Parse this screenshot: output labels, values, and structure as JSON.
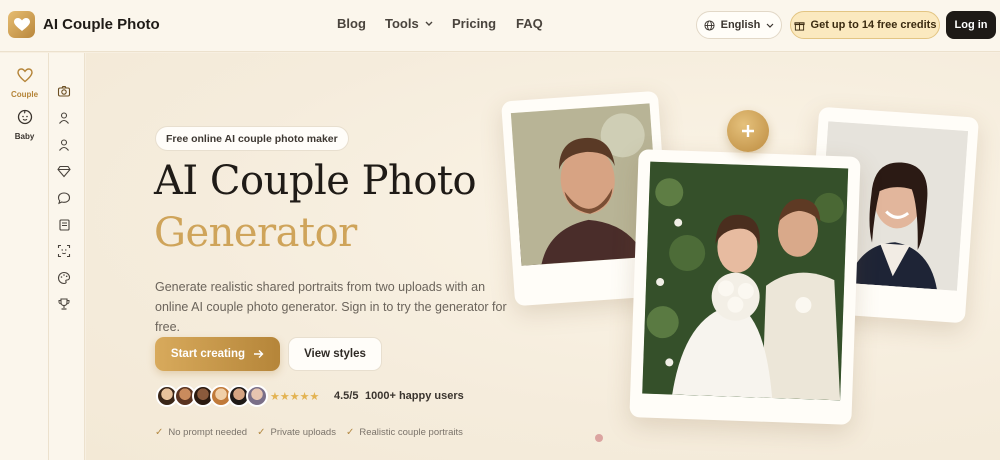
{
  "header": {
    "logo_text": "AI Couple Photo",
    "nav": {
      "blog": "Blog",
      "tools": "Tools",
      "pricing": "Pricing",
      "faq": "FAQ"
    },
    "language": "English",
    "credits": "Get up to 14 free credits",
    "login": "Log in"
  },
  "sidebar": {
    "items": [
      {
        "label": "Couple",
        "icon": "heart-icon"
      },
      {
        "label": "Baby",
        "icon": "baby-face-icon"
      }
    ],
    "tool_icons": [
      "camera-icon",
      "user-icon",
      "user-alt-icon",
      "diamond-icon",
      "chat-bubble-icon",
      "scroll-icon",
      "face-scan-icon",
      "palette-icon",
      "trophy-icon"
    ]
  },
  "hero": {
    "badge": "Free online AI couple photo maker",
    "title_line1": "AI Couple Photo",
    "title_line2": "Generator",
    "description": "Generate realistic shared portraits from two uploads with an online AI couple photo generator. Sign in to try the generator for free.",
    "start_button": "Start creating",
    "view_button": "View styles",
    "rating": "4.5/5",
    "users": "1000+ happy users",
    "stars": "★★★★★",
    "checks": [
      "No prompt needed",
      "Private uploads",
      "Realistic couple portraits"
    ]
  },
  "colors": {
    "accent": "#cfa45a",
    "background": "#f7efe1",
    "dark": "#1e1a16"
  }
}
